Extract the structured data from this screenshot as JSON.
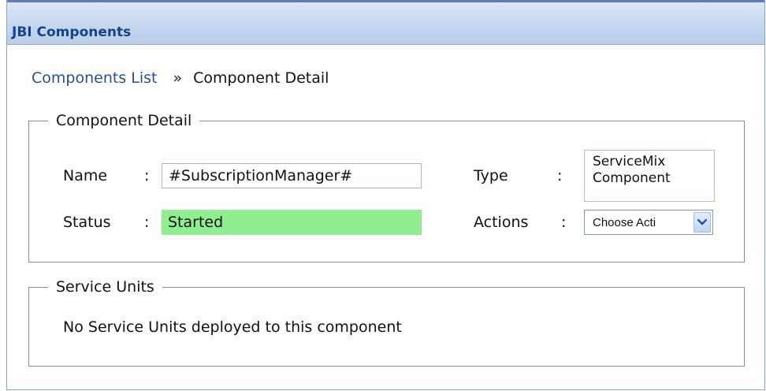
{
  "panel": {
    "title": "JBI Components"
  },
  "breadcrumb": {
    "link": "Components List",
    "separator": "»",
    "current": "Component Detail"
  },
  "detail": {
    "legend": "Component Detail",
    "name_label": "Name",
    "name_value": "#SubscriptionManager#",
    "type_label": "Type",
    "type_value_line1": "ServiceMix",
    "type_value_line2": "Component",
    "status_label": "Status",
    "status_value": "Started",
    "status_color": "#90ee90",
    "actions_label": "Actions",
    "actions_selected": "Choose Acti",
    "colon": ":"
  },
  "service_units": {
    "legend": "Service Units",
    "message": "No Service Units deployed to this component"
  },
  "icons": {
    "dropdown": "chevron-down-icon"
  }
}
